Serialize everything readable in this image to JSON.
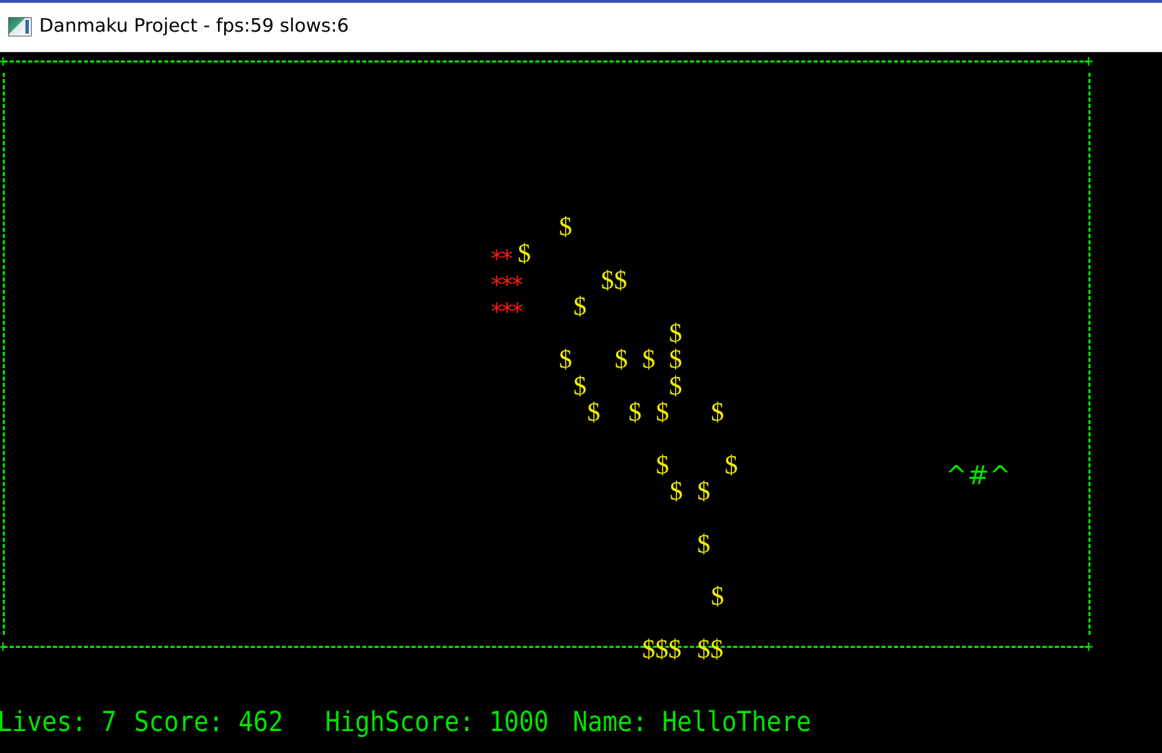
{
  "window": {
    "title": "Danmaku Project - fps:59 slows:6",
    "icon": "console-app-icon"
  },
  "hud": {
    "lives": "Lives: 7",
    "score": "Score: 462",
    "highscore": "HighScore: 1000",
    "name": "Name: HelloThere"
  },
  "game": {
    "player": "^#^",
    "enemy_rows": [
      "**",
      "***",
      "***"
    ],
    "bullet_glyph": "$",
    "bullet_groups": [
      "$",
      "$",
      "$$",
      "$",
      "$",
      "$",
      "$",
      "$",
      "$",
      "$",
      "$",
      "$",
      "$",
      "$",
      "$",
      "$",
      "$",
      "$",
      "$",
      "$",
      "$",
      "$",
      "$$$",
      "$$"
    ],
    "colors": {
      "border": "#00e600",
      "bullet": "#f2ef00",
      "enemy": "#ff1a1a",
      "player": "#00e600",
      "background": "#000000"
    }
  }
}
